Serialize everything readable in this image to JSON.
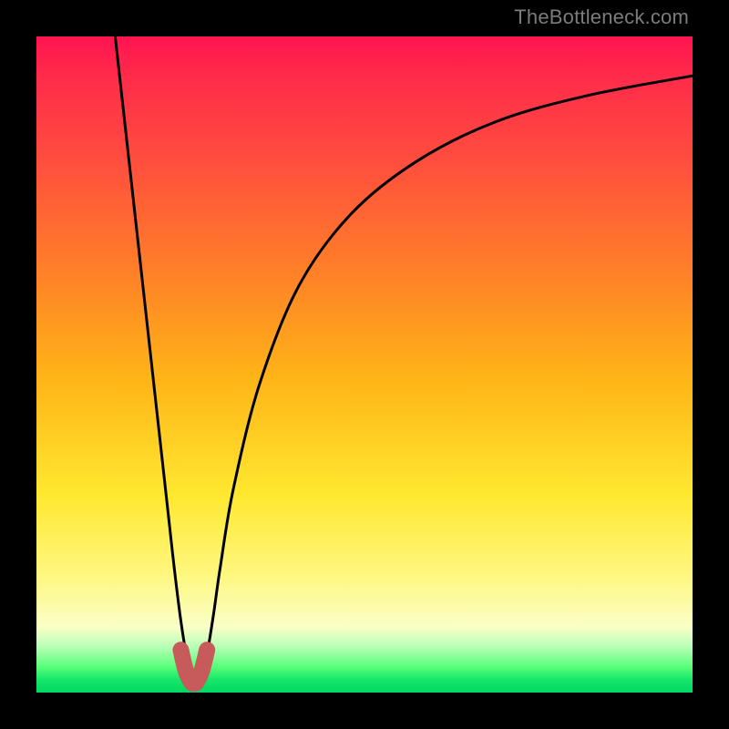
{
  "attribution": "TheBottleneck.com",
  "chart_data": {
    "type": "line",
    "title": "",
    "xlabel": "",
    "ylabel": "",
    "xlim": [
      0,
      100
    ],
    "ylim": [
      0,
      100
    ],
    "grid": false,
    "series": [
      {
        "name": "bottleneck-curve",
        "color": "#000000",
        "x": [
          12,
          14,
          16,
          18,
          20,
          21,
          22,
          23,
          24,
          25,
          26,
          27,
          28,
          30,
          34,
          40,
          48,
          58,
          70,
          84,
          100
        ],
        "values": [
          100,
          82,
          64,
          46,
          28,
          19,
          11,
          5,
          2,
          3,
          6,
          12,
          19,
          31,
          47,
          62,
          73,
          81,
          87,
          91,
          94
        ]
      },
      {
        "name": "optimum-marker",
        "color": "#c75a5a",
        "x": [
          22.0,
          22.8,
          23.6,
          24.0,
          24.4,
          25.2,
          26.0
        ],
        "values": [
          6.5,
          3.2,
          1.6,
          1.4,
          1.6,
          3.3,
          6.5
        ]
      }
    ],
    "background_gradient_stops": [
      {
        "pos": 0,
        "color": "#ff1450"
      },
      {
        "pos": 18,
        "color": "#ff4b3f"
      },
      {
        "pos": 52,
        "color": "#ffb417"
      },
      {
        "pos": 82,
        "color": "#fff77f"
      },
      {
        "pos": 96,
        "color": "#5cff7a"
      },
      {
        "pos": 100,
        "color": "#00d860"
      }
    ]
  }
}
